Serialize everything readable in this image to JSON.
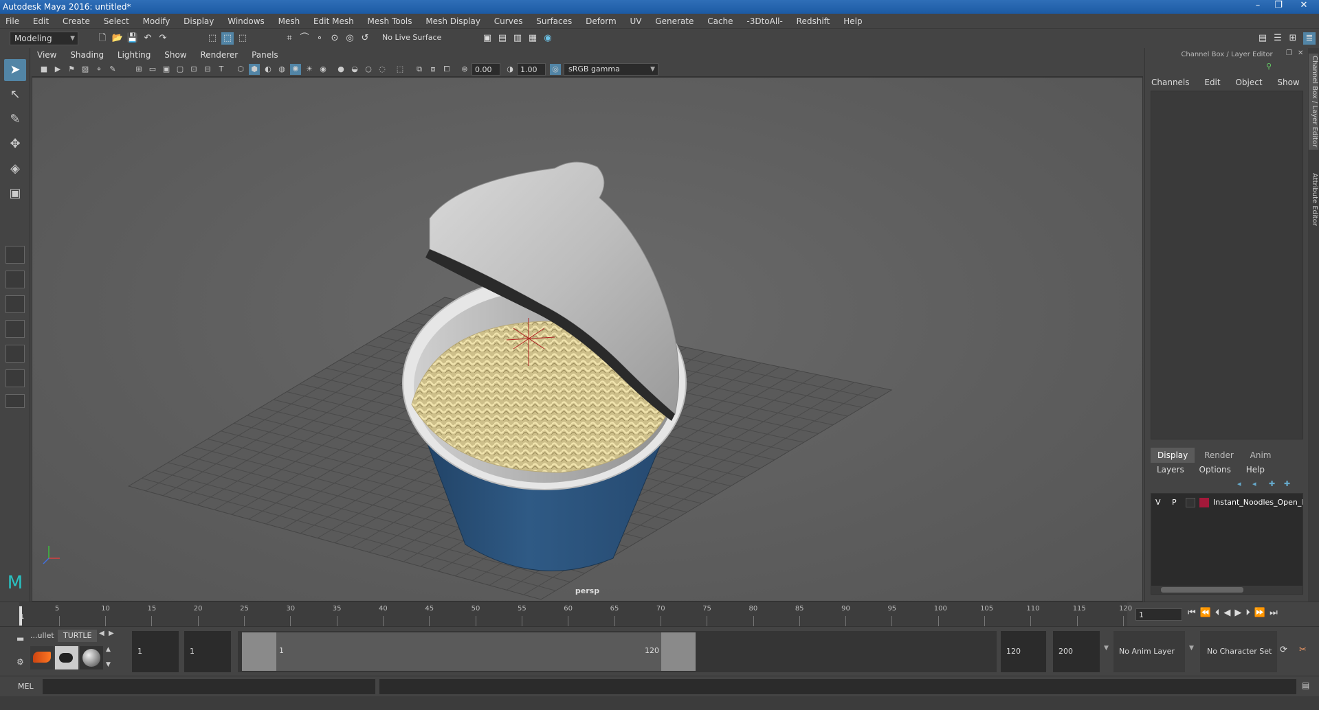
{
  "window": {
    "title": "Autodesk Maya 2016: untitled*"
  },
  "menubar": [
    "File",
    "Edit",
    "Create",
    "Select",
    "Modify",
    "Display",
    "Windows",
    "Mesh",
    "Edit Mesh",
    "Mesh Tools",
    "Mesh Display",
    "Curves",
    "Surfaces",
    "Deform",
    "UV",
    "Generate",
    "Cache",
    "-3DtoAll-",
    "Redshift",
    "Help"
  ],
  "toolbar": {
    "mode": "Modeling",
    "live_surface": "No Live Surface"
  },
  "viewport": {
    "menu": [
      "View",
      "Shading",
      "Lighting",
      "Show",
      "Renderer",
      "Panels"
    ],
    "exposure": "0.00",
    "gamma": "1.00",
    "color_space": "sRGB gamma",
    "camera": "persp"
  },
  "channel_box": {
    "title": "Channel Box / Layer Editor",
    "menu": [
      "Channels",
      "Edit",
      "Object",
      "Show"
    ],
    "layer_tabs": [
      "Display",
      "Render",
      "Anim"
    ],
    "layer_menu": [
      "Layers",
      "Options",
      "Help"
    ],
    "layer": {
      "v": "V",
      "p": "P",
      "name": "Instant_Noodles_Open_l",
      "color": "#a3193a"
    },
    "side_tabs": [
      "Channel Box / Layer Editor",
      "Attribute Editor"
    ]
  },
  "timeline": {
    "ticks": [
      "5",
      "10",
      "15",
      "20",
      "25",
      "30",
      "35",
      "40",
      "45",
      "50",
      "55",
      "60",
      "65",
      "70",
      "75",
      "80",
      "85",
      "90",
      "95",
      "100",
      "105",
      "110",
      "115",
      "120"
    ],
    "start_label": "1",
    "current_frame": "1"
  },
  "shelf": {
    "tabs": [
      "...ullet",
      "TURTLE"
    ]
  },
  "range": {
    "start": "1",
    "playback_start": "1",
    "slider_start": "1",
    "slider_end": "120",
    "playback_end": "120",
    "end": "200",
    "anim_layer": "No Anim Layer",
    "character_set": "No Character Set"
  },
  "mel": {
    "label": "MEL"
  }
}
